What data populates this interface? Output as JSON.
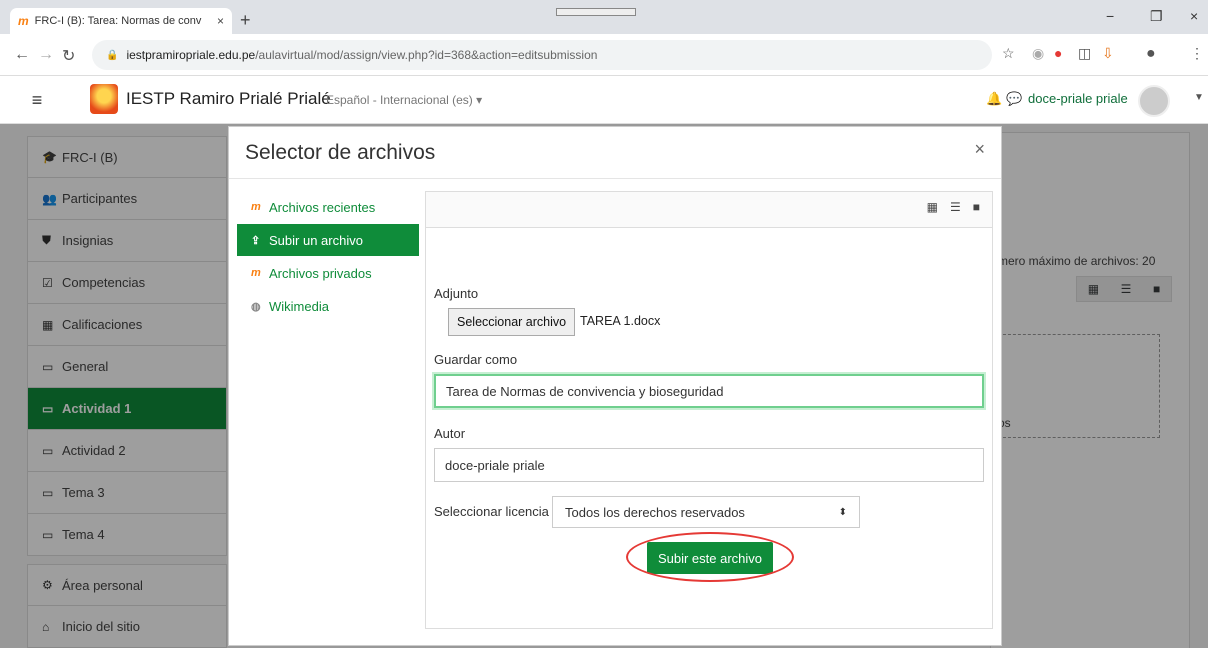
{
  "browser": {
    "tab_title": "FRC-I (B): Tarea: Normas de conv",
    "tab_favicon": "m",
    "tab_close": "×",
    "new_tab": "+",
    "url_domain": "iestpramiropriale.edu.pe",
    "url_path": "/aulavirtual/mod/assign/view.php?id=368&action=editsubmission",
    "controls": {
      "minimize": "−",
      "restore": "❐",
      "close": "×"
    }
  },
  "navbar": {
    "menu_icon": "≡",
    "site_name": "IESTP Ramiro Prialé Prialé",
    "language": "Español - Internacional (es) ▾",
    "user_name": "doce-priale priale"
  },
  "sidebar": {
    "items": [
      {
        "label": "FRC-I (B)",
        "icon": "🎓"
      },
      {
        "label": "Participantes",
        "icon": "👥"
      },
      {
        "label": "Insignias",
        "icon": "⛊"
      },
      {
        "label": "Competencias",
        "icon": "☑"
      },
      {
        "label": "Calificaciones",
        "icon": "▦"
      },
      {
        "label": "General",
        "icon": "▭"
      },
      {
        "label": "Actividad 1",
        "icon": "▭"
      },
      {
        "label": "Actividad 2",
        "icon": "▭"
      },
      {
        "label": "Tema 3",
        "icon": "▭"
      },
      {
        "label": "Tema 4",
        "icon": "▭"
      },
      {
        "label": "Área personal",
        "icon": "⚙"
      },
      {
        "label": "Inicio del sitio",
        "icon": "⌂"
      }
    ]
  },
  "background": {
    "max_files": "mero máximo de archivos: 20",
    "drop_text": "os"
  },
  "modal": {
    "title": "Selector de archivos",
    "close": "×",
    "repositories": [
      {
        "label": "Archivos recientes",
        "icon": "m"
      },
      {
        "label": "Subir un archivo",
        "icon": "⇪"
      },
      {
        "label": "Archivos privados",
        "icon": "m"
      },
      {
        "label": "Wikimedia",
        "icon": "◍"
      }
    ],
    "attachment_label": "Adjunto",
    "choose_file_button": "Seleccionar archivo",
    "chosen_file": "TAREA 1.docx",
    "save_as_label": "Guardar como",
    "save_as_value": "Tarea de Normas de convivencia y bioseguridad",
    "author_label": "Autor",
    "author_value": "doce-priale priale",
    "license_label": "Seleccionar licencia",
    "license_value": "Todos los derechos reservados",
    "upload_button": "Subir este archivo"
  }
}
